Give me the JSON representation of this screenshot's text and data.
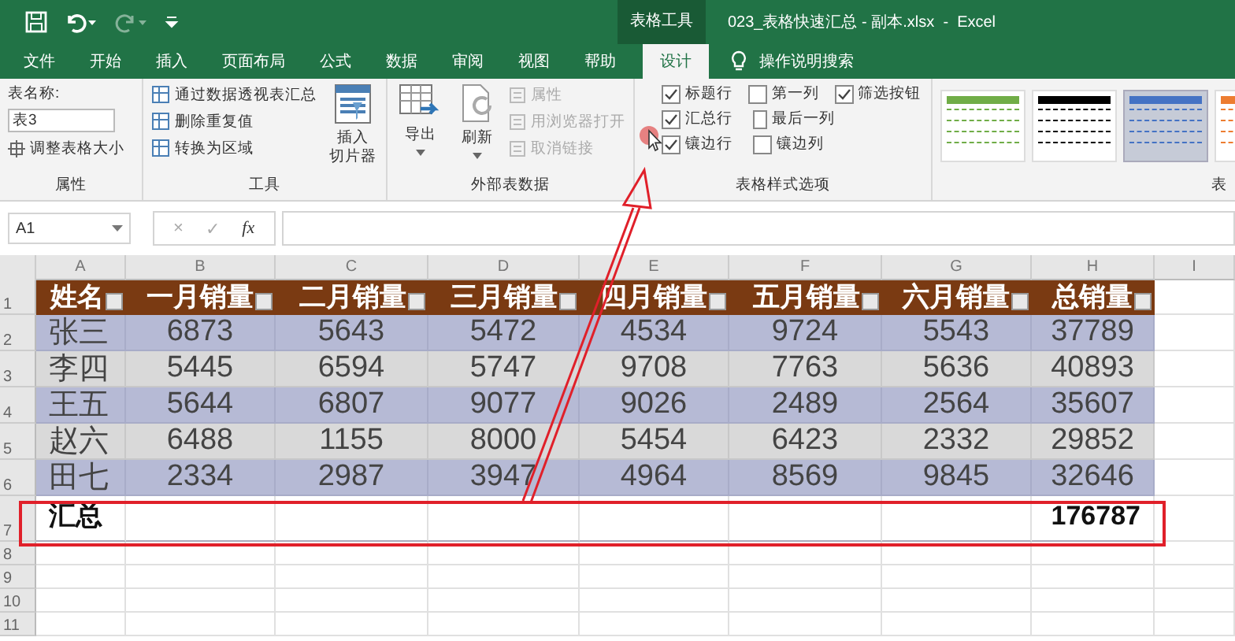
{
  "title_bar": {
    "context_tab": "表格工具",
    "title": "023_表格快速汇总 - 副本.xlsx  -  Excel"
  },
  "tabs": [
    {
      "label": "文件",
      "selected": false
    },
    {
      "label": "开始",
      "selected": false
    },
    {
      "label": "插入",
      "selected": false
    },
    {
      "label": "页面布局",
      "selected": false
    },
    {
      "label": "公式",
      "selected": false
    },
    {
      "label": "数据",
      "selected": false
    },
    {
      "label": "审阅",
      "selected": false
    },
    {
      "label": "视图",
      "selected": false
    },
    {
      "label": "帮助",
      "selected": false
    },
    {
      "label": "设计",
      "selected": true
    }
  ],
  "tell_me": "操作说明搜索",
  "ribbon": {
    "properties": {
      "name_label": "表名称:",
      "name_value": "表3",
      "resize": "调整表格大小",
      "group": "属性"
    },
    "tools": {
      "buttons": [
        "通过数据透视表汇总",
        "删除重复值",
        "转换为区域"
      ],
      "slicer": [
        "插入",
        "切片器"
      ],
      "group": "工具"
    },
    "external": {
      "export": "导出",
      "refresh": "刷新",
      "buttons": [
        {
          "label": "属性",
          "disabled": true
        },
        {
          "label": "用浏览器打开",
          "disabled": true
        },
        {
          "label": "取消链接",
          "disabled": true
        }
      ],
      "group": "外部表数据"
    },
    "style_options": {
      "rows": [
        [
          {
            "label": "标题行",
            "checked": true
          },
          {
            "label": "第一列",
            "checked": false
          },
          {
            "label": "筛选按钮",
            "checked": true
          }
        ],
        [
          {
            "label": "汇总行",
            "checked": true
          },
          {
            "label": "最后一列",
            "checked": false
          }
        ],
        [
          {
            "label": "镶边行",
            "checked": true
          },
          {
            "label": "镶边列",
            "checked": false
          }
        ]
      ],
      "group": "表格样式选项"
    },
    "styles": {
      "items": [
        {
          "color": "#70ad47",
          "selected": false
        },
        {
          "color": "#000000",
          "selected": false
        },
        {
          "color": "#4472c4",
          "selected": true
        },
        {
          "color": "#ed7d31",
          "selected": false
        }
      ],
      "group": "表"
    }
  },
  "formula_bar": {
    "name_box": "A1",
    "cancel": "×",
    "enter": "✓",
    "fx": "fx"
  },
  "sheet": {
    "columns": [
      "A",
      "B",
      "C",
      "D",
      "E",
      "F",
      "G",
      "H",
      "I"
    ],
    "header": [
      "姓名",
      "一月销量",
      "二月销量",
      "三月销量",
      "四月销量",
      "五月销量",
      "六月销量",
      "总销量"
    ],
    "rows": [
      {
        "number": "2",
        "cells": [
          "张三",
          "6873",
          "5643",
          "5472",
          "4534",
          "9724",
          "5543",
          "37789"
        ]
      },
      {
        "number": "3",
        "cells": [
          "李四",
          "5445",
          "6594",
          "5747",
          "9708",
          "7763",
          "5636",
          "40893"
        ]
      },
      {
        "number": "4",
        "cells": [
          "王五",
          "5644",
          "6807",
          "9077",
          "9026",
          "2489",
          "2564",
          "35607"
        ]
      },
      {
        "number": "5",
        "cells": [
          "赵六",
          "6488",
          "1155",
          "8000",
          "5454",
          "6423",
          "2332",
          "29852"
        ]
      },
      {
        "number": "6",
        "cells": [
          "田七",
          "2334",
          "2987",
          "3947",
          "4964",
          "8569",
          "9845",
          "32646"
        ]
      }
    ],
    "header_number": "1",
    "total": {
      "number": "7",
      "label": "汇总",
      "value": "176787"
    },
    "empty_rows": [
      "8",
      "9",
      "10",
      "11"
    ]
  }
}
